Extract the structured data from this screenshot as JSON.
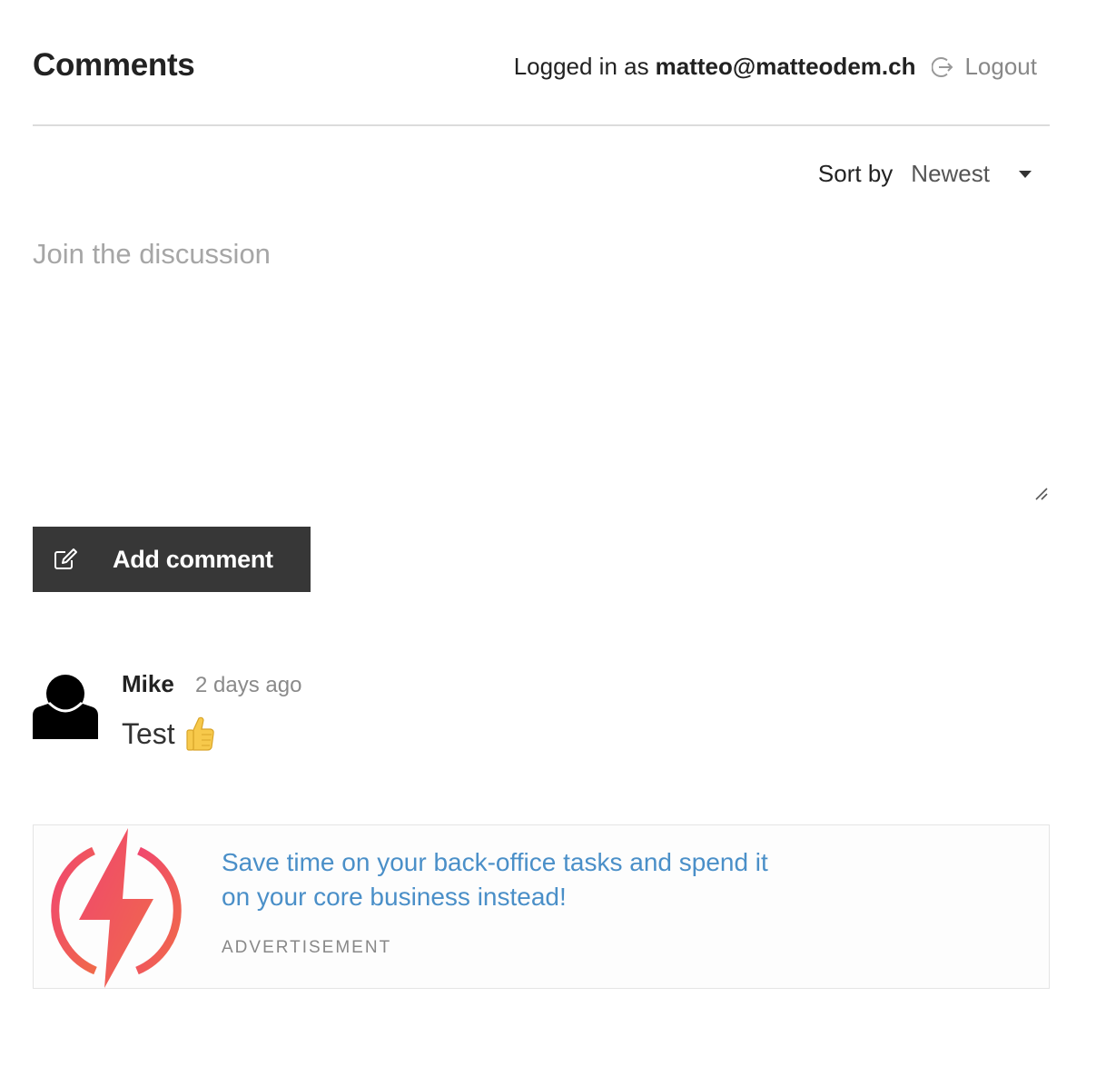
{
  "header": {
    "title": "Comments",
    "logged_in_prefix": "Logged in as",
    "email": "matteo@matteodem.ch",
    "logout_label": "Logout"
  },
  "sort": {
    "label": "Sort by",
    "selected": "Newest"
  },
  "composer": {
    "placeholder": "Join the discussion",
    "value": "",
    "submit_label": "Add comment"
  },
  "comments": [
    {
      "author": "Mike",
      "time": "2 days ago",
      "text": "Test",
      "emoji_icon": "thumbs-up-icon"
    }
  ],
  "ad": {
    "text": "Save time on your back-office tasks and spend it on your core business instead!",
    "tag": "ADVERTISEMENT"
  },
  "colors": {
    "button_bg": "#373737",
    "ad_link": "#4a8fc8",
    "logo_gradient_start": "#f0466f",
    "logo_gradient_end": "#f06a4a"
  }
}
